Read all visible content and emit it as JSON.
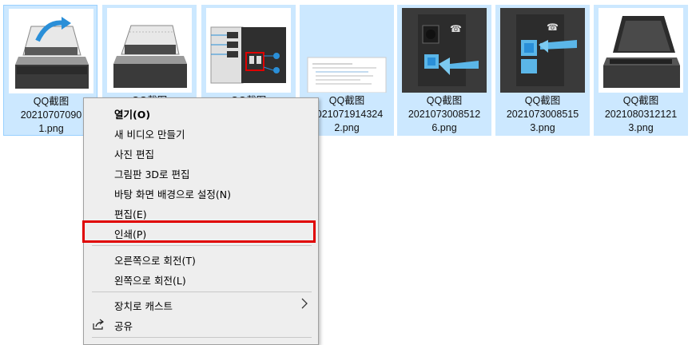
{
  "files": [
    {
      "line1": "QQ截图",
      "line2": "20210707090",
      "line3": "1.png",
      "thumb": "scanner-lid-open-arrow"
    },
    {
      "line1": "QQ截图",
      "line2": "",
      "line3": "",
      "thumb": "scanner-lid-open"
    },
    {
      "line1": "QQ截图",
      "line2": "",
      "line3": "",
      "thumb": "printer-back-panel-ports"
    },
    {
      "line1": "QQ截图",
      "line2": "2021071914324",
      "line3": "2.png",
      "thumb": "document-page"
    },
    {
      "line1": "QQ截图",
      "line2": "2021073008512",
      "line3": "6.png",
      "thumb": "fax-port-plug"
    },
    {
      "line1": "QQ截图",
      "line2": "2021073008515",
      "line3": "3.png",
      "thumb": "phone-port-plug"
    },
    {
      "line1": "QQ截图",
      "line2": "2021080312121",
      "line3": "3.png",
      "thumb": "scanner-glass-open"
    }
  ],
  "context_menu": {
    "open": "열기(O)",
    "new_video": "새 비디오 만들기",
    "edit_photo": "사진 편집",
    "paint3d": "그림판 3D로 편집",
    "set_wallpaper": "바탕 화면 배경으로 설정(N)",
    "edit": "편집(E)",
    "print": "인쇄(P)",
    "rotate_right": "오른쪽으로 회전(T)",
    "rotate_left": "왼쪽으로 회전(L)",
    "cast": "장치로 캐스트",
    "share": "공유"
  },
  "colors": {
    "selection": "#cce8ff",
    "highlight_box": "#e00000",
    "menu_bg": "#eeeeee"
  }
}
